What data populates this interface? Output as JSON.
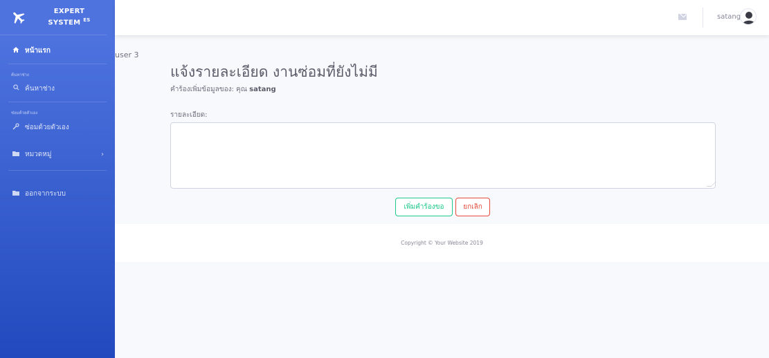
{
  "brand": {
    "line1": "EXPERT",
    "line2": "SYSTEM",
    "sup": "ES",
    "icon": "airplane-icon"
  },
  "sidebar": {
    "home": {
      "label": "หน้าแรก",
      "icon": "home-icon"
    },
    "heading_search": "ค้นหาช่าง",
    "search_tech": {
      "label": "ค้นหาช่าง",
      "icon": "search-icon"
    },
    "heading_self": "ซ่อมด้วยตัวเอง",
    "self_repair": {
      "label": "ซ่อมด้วยตัวเอง",
      "icon": "wrench-icon"
    },
    "category": {
      "label": "หมวดหมู่",
      "icon": "folder-icon",
      "chevron": "›"
    },
    "logout": {
      "label": "ออกจากระบบ",
      "icon": "folder-icon"
    }
  },
  "topbar": {
    "mail_icon": "envelope-icon",
    "username": "satang",
    "avatar_icon": "user-avatar-icon"
  },
  "content": {
    "breadcrumb": "user 3",
    "title": "แจ้งรายละเอียด งานซ่อมที่ยังไม่มี",
    "subtitle_prefix": "คำร้องเพิ่มข้อมูลของ: คุณ ",
    "subtitle_user": "satang",
    "detail_label": "รายละเอียด:",
    "detail_value": "",
    "add_button": "เพิ่มคำร้องขอ",
    "cancel_button": "ยกเลิก"
  },
  "footer": {
    "copyright": "Copyright © Your Website 2019"
  },
  "colors": {
    "sidebar_top": "#4e73df",
    "sidebar_bottom": "#224abe",
    "success": "#1cc88a",
    "danger": "#e74a3b"
  }
}
